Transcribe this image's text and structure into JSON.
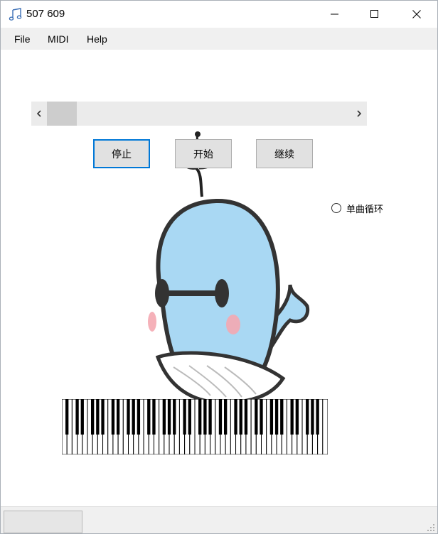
{
  "window": {
    "title": "507 609",
    "minimize_label": "Minimize",
    "maximize_label": "Maximize",
    "close_label": "Close"
  },
  "menubar": {
    "items": [
      "File",
      "MIDI",
      "Help"
    ]
  },
  "controls": {
    "stop_label": "停止",
    "start_label": "开始",
    "resume_label": "继续",
    "loop_label": "单曲循环",
    "loop_checked": false
  },
  "scrollbar": {
    "position_fraction": 0.0
  },
  "piano": {
    "white_keys": 52
  },
  "colors": {
    "accent": "#0078d7",
    "button_face": "#e1e1e1",
    "menubar_bg": "#f0f0f0",
    "whale_body": "#a9d8f3",
    "whale_cheek": "#f4a9b1"
  },
  "icons": {
    "app": "music-note-icon",
    "minimize": "minimize-icon",
    "maximize": "maximize-icon",
    "close": "close-icon",
    "scroll_left": "chevron-left-icon",
    "scroll_right": "chevron-right-icon",
    "resize_grip": "resize-grip-icon"
  }
}
